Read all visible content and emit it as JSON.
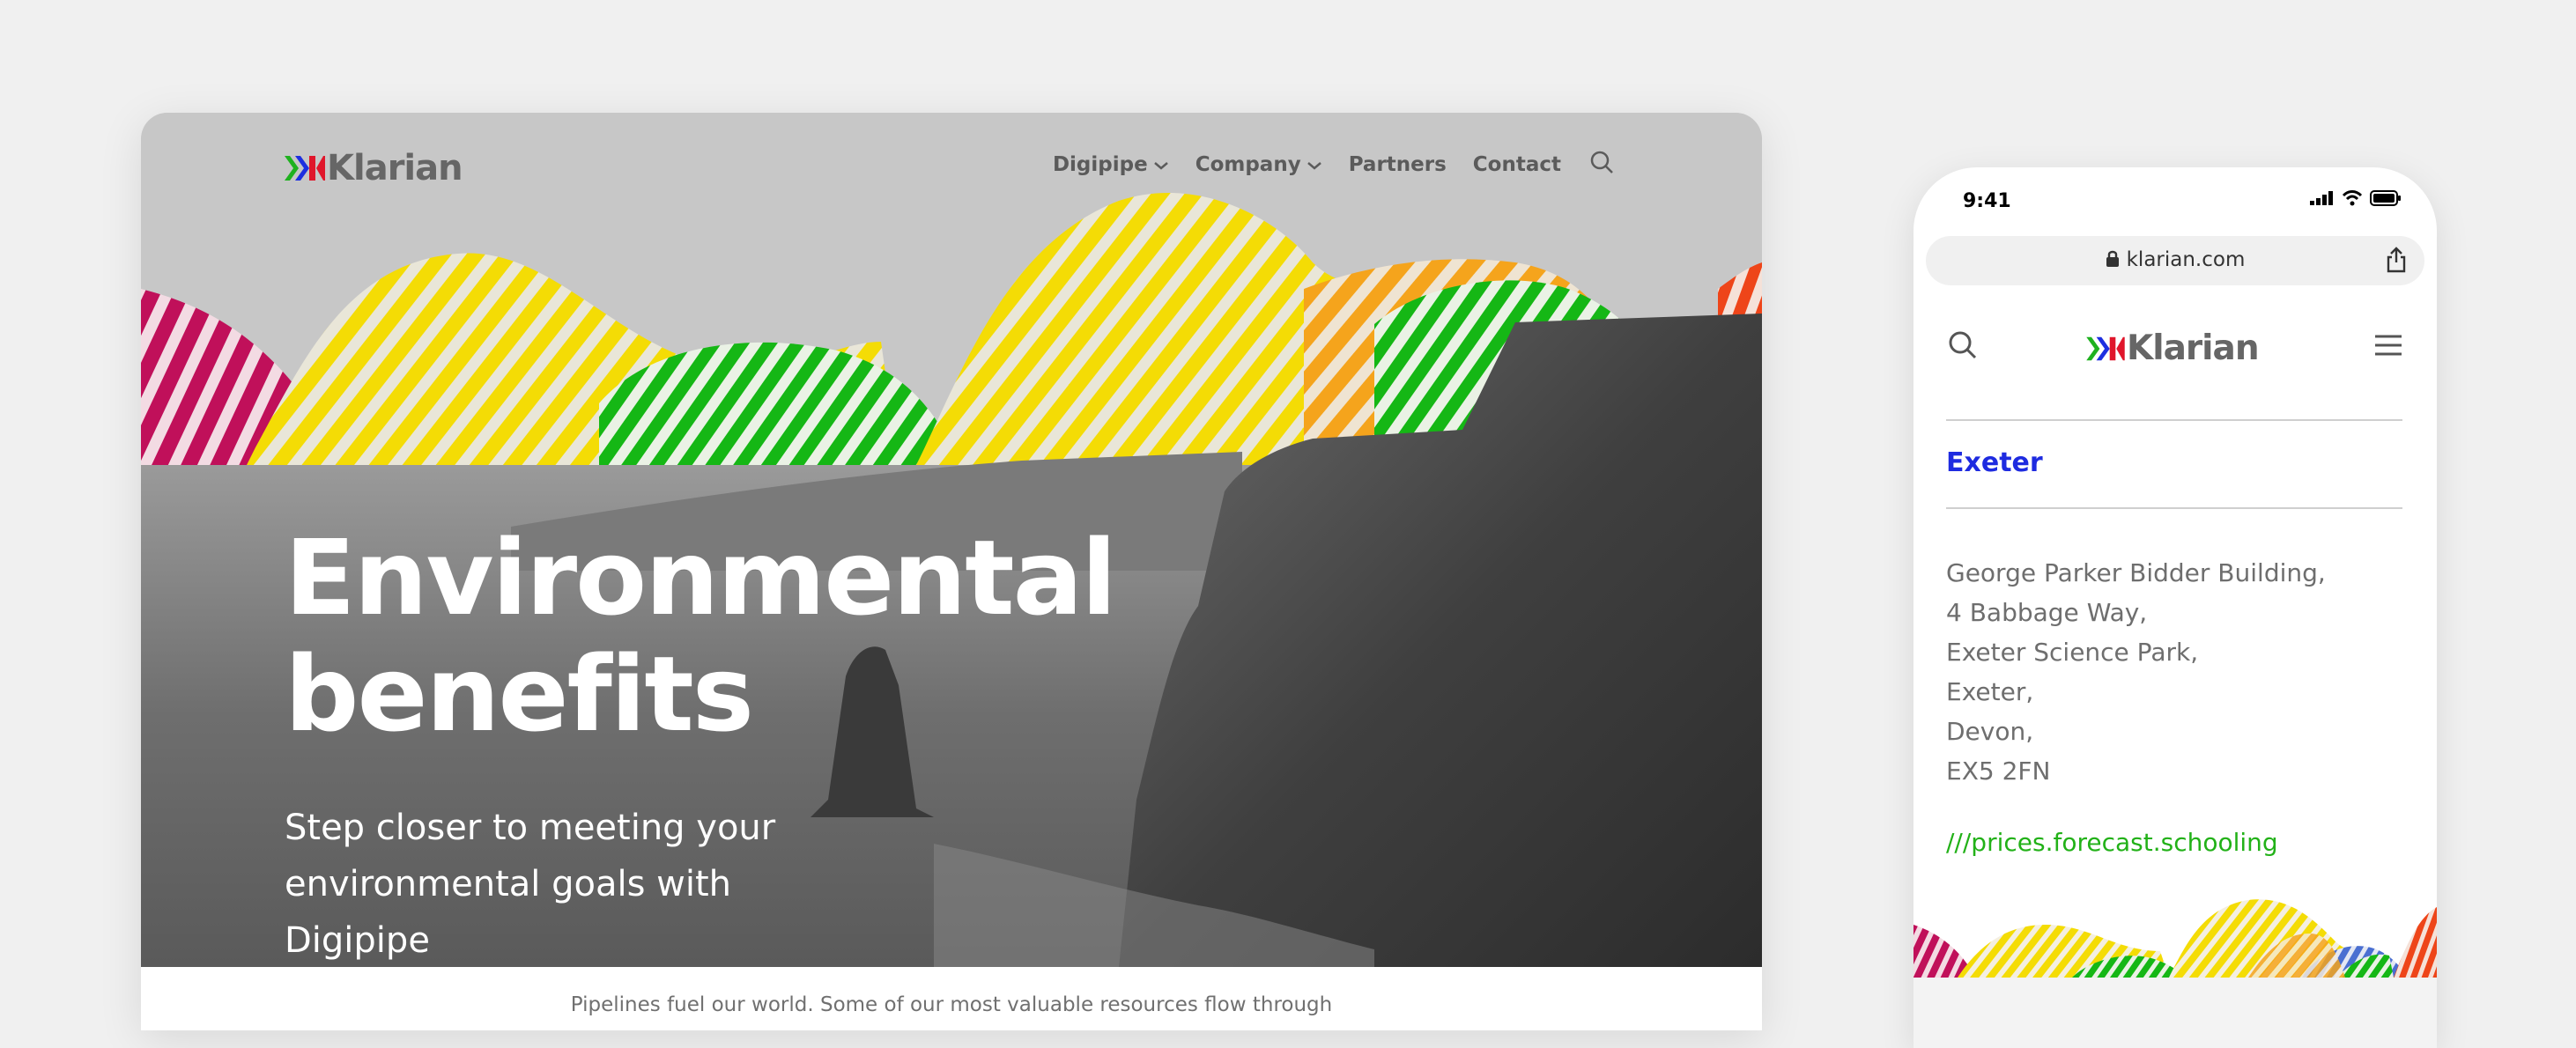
{
  "brand": {
    "name": "Klarian",
    "logo_word": "Klarian",
    "colors": {
      "chevron_green": "#1fb11f",
      "chevron_blue": "#1d2fe0",
      "chevron_red": "#e0162b",
      "wordmark": "#666666"
    }
  },
  "desktop": {
    "nav": {
      "items": [
        {
          "label": "Digipipe",
          "has_dropdown": true
        },
        {
          "label": "Company",
          "has_dropdown": true
        },
        {
          "label": "Partners",
          "has_dropdown": false
        },
        {
          "label": "Contact",
          "has_dropdown": false
        }
      ],
      "search_icon": "search-icon"
    },
    "hero": {
      "title_line1": "Environmental",
      "title_line2": "benefits",
      "subtitle": "Step closer to meeting your environmental goals with Digipipe"
    },
    "intro_text": "Pipelines fuel our world. Some of our most valuable resources flow through"
  },
  "phone": {
    "status": {
      "time": "9:41"
    },
    "url": "klarian.com",
    "city": "Exeter",
    "address_lines": [
      "George Parker Bidder Building,",
      "4 Babbage Way,",
      "Exeter Science Park,",
      "Exeter,",
      "Devon,",
      "EX5 2FN"
    ],
    "what3words": "///prices.forecast.schooling",
    "colors": {
      "city": "#1e2be0",
      "link": "#22b118",
      "address": "#6e6e6e"
    }
  }
}
